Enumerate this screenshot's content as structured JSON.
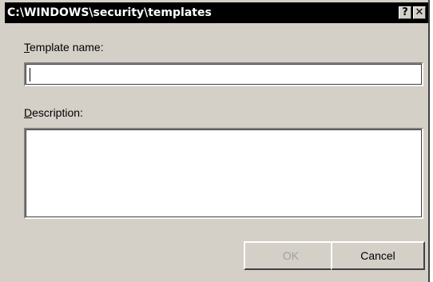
{
  "window": {
    "title": "C:\\WINDOWS\\security\\templates",
    "help_glyph": "?",
    "close_glyph": "✕"
  },
  "template_name": {
    "label_accel": "T",
    "label_rest": "emplate name:",
    "value": ""
  },
  "description": {
    "label_accel": "D",
    "label_rest": "escription:",
    "value": ""
  },
  "buttons": {
    "ok": "OK",
    "ok_enabled": false,
    "cancel": "Cancel"
  },
  "icons": [
    "help-icon",
    "close-icon"
  ],
  "colors": {
    "face": "#d4d0c8",
    "titlebar": "#000000",
    "disabled_text": "#a0a0a0"
  }
}
